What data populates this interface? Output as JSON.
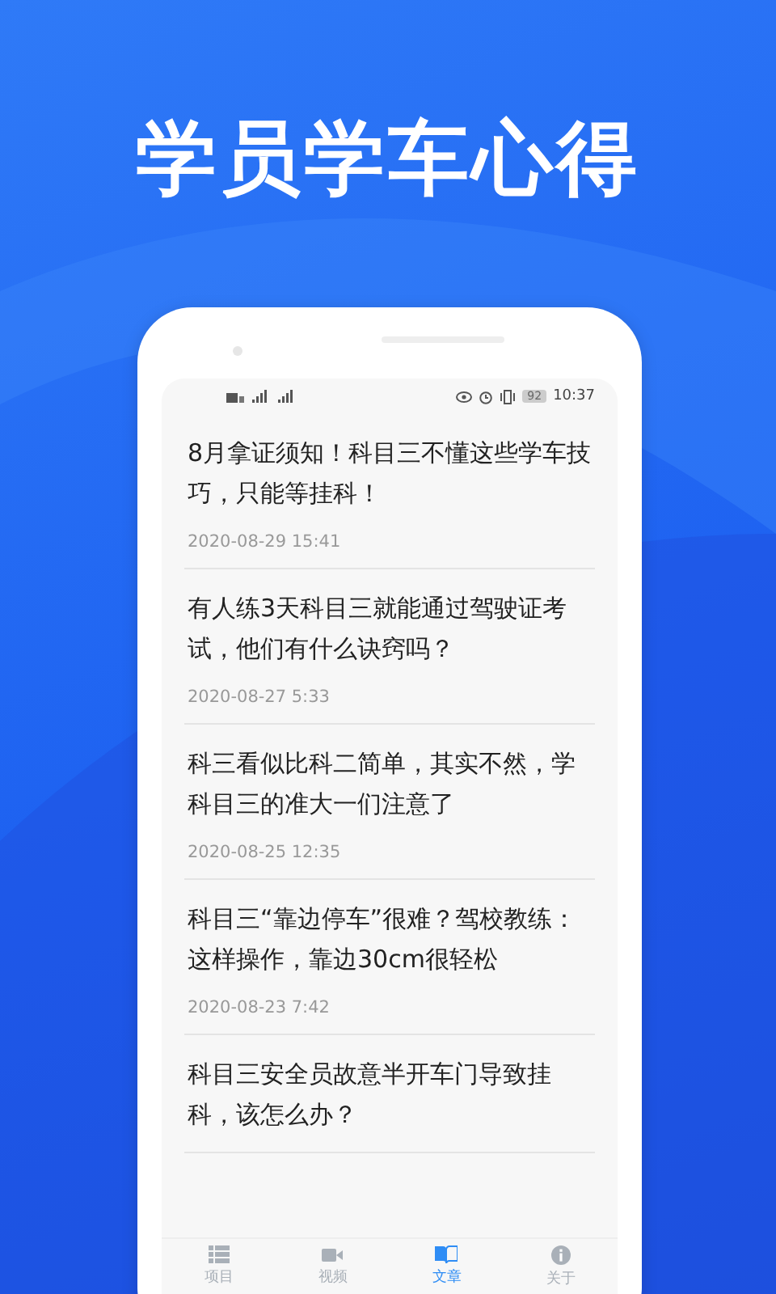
{
  "headline": "学员学车心得",
  "status_bar": {
    "battery": "92",
    "time": "10:37"
  },
  "articles": [
    {
      "title": "8月拿证须知！科目三不懂这些学车技巧，只能等挂科！",
      "date": "2020-08-29 15:41"
    },
    {
      "title": "有人练3天科目三就能通过驾驶证考试，他们有什么诀窍吗？",
      "date": "2020-08-27 5:33"
    },
    {
      "title": "科三看似比科二简单，其实不然，学科目三的准大一们注意了",
      "date": "2020-08-25 12:35"
    },
    {
      "title": "科目三“靠边停车”很难？驾校教练：这样操作，靠边30cm很轻松",
      "date": "2020-08-23 7:42"
    },
    {
      "title": "科目三安全员故意半开车门导致挂科，该怎么办？"
    }
  ],
  "tabs": [
    {
      "kind": "list",
      "label": "项目",
      "selected": false
    },
    {
      "kind": "video",
      "label": "视频",
      "selected": false
    },
    {
      "kind": "book",
      "label": "文章",
      "selected": true
    },
    {
      "kind": "info",
      "label": "关于",
      "selected": false
    }
  ]
}
